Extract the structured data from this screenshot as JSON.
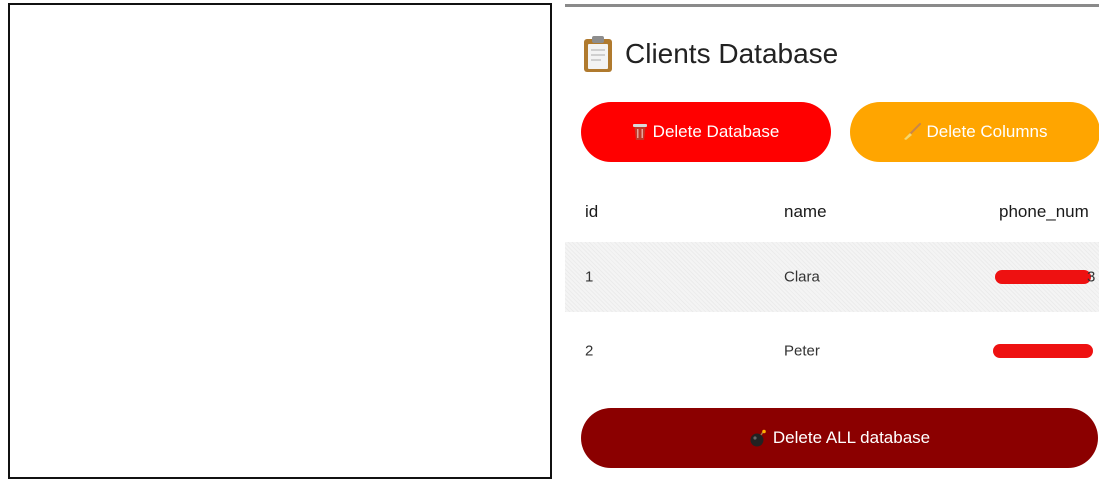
{
  "app": {
    "title": "Clients Database"
  },
  "buttons": {
    "delete_database": "Delete Database",
    "delete_columns": "Delete Columns",
    "delete_all": "Delete ALL database"
  },
  "table": {
    "headers": [
      "id",
      "name",
      "phone_num"
    ],
    "rows": [
      {
        "id": "1",
        "name": "Clara",
        "phone_visible": "3"
      },
      {
        "id": "2",
        "name": "Peter",
        "phone_visible": ""
      }
    ]
  },
  "colors": {
    "delete_database": "#ff0000",
    "delete_columns": "#ffa500",
    "delete_all": "#8b0000",
    "redaction": "#ee1111"
  },
  "icons": {
    "title": "clipboard-icon",
    "delete_database": "trash-icon",
    "delete_columns": "broom-icon",
    "delete_all": "bomb-icon"
  }
}
